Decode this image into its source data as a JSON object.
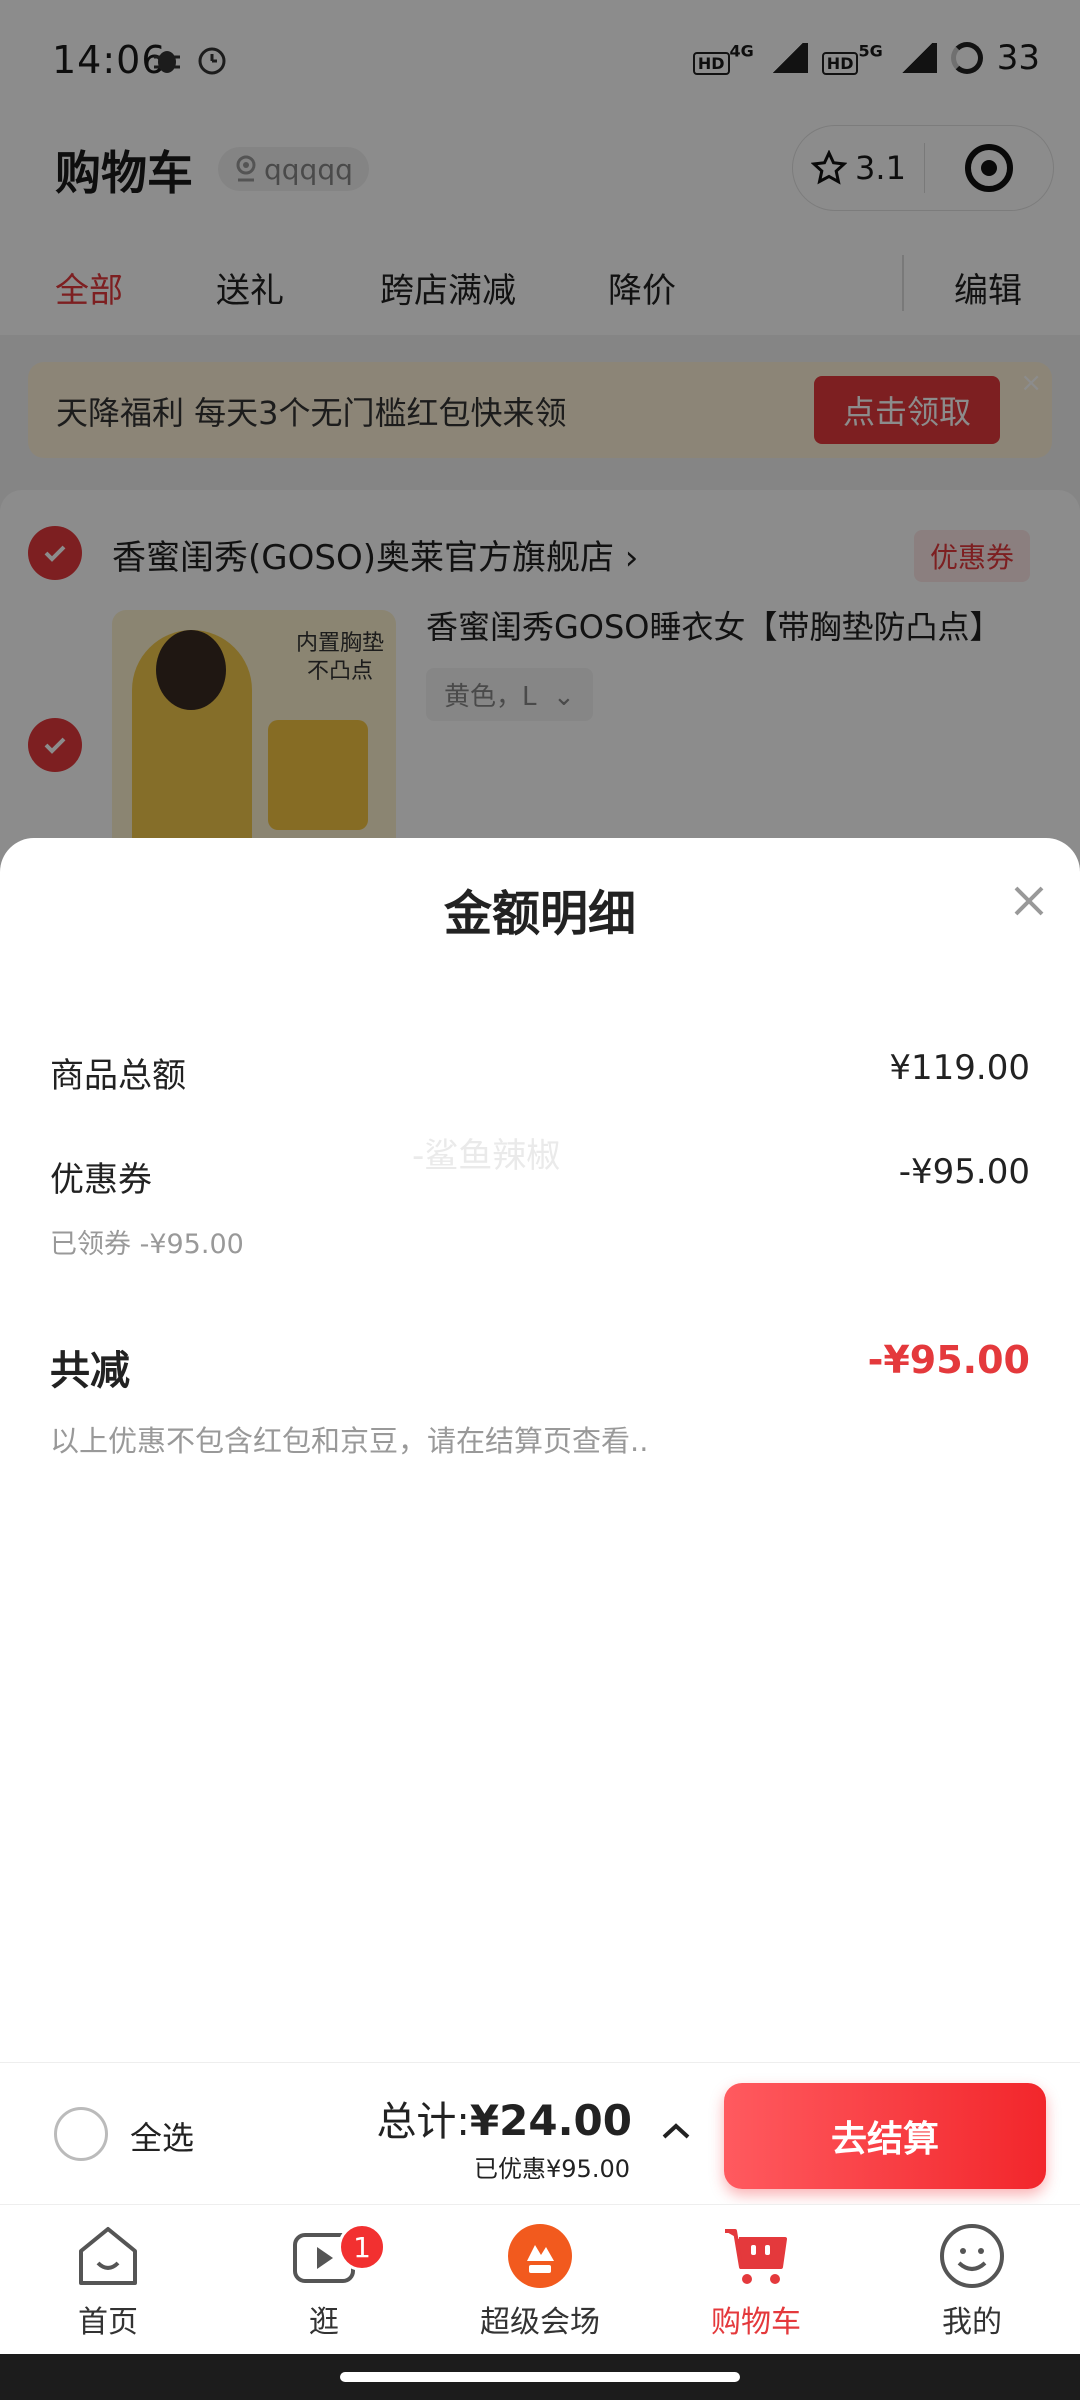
{
  "status_bar": {
    "time": "14:06",
    "network_1": "HD",
    "network_1_gen": "4G",
    "network_2": "HD",
    "network_2_gen": "5G",
    "battery": "33"
  },
  "header": {
    "title": "购物车",
    "address": "qqqqq",
    "capsule_rating": "3.1"
  },
  "tabs": [
    {
      "label": "全部",
      "active": true
    },
    {
      "label": "送礼",
      "active": false
    },
    {
      "label": "跨店满减",
      "active": false
    },
    {
      "label": "降价",
      "active": false
    }
  ],
  "edit_label": "编辑",
  "banner": {
    "text": "天降福利 每天3个无门槛红包快来领",
    "button": "点击领取",
    "close": "×"
  },
  "store": {
    "name": "香蜜闺秀(GOSO)奥莱官方旗舰店",
    "chevron": "›",
    "coupon_tag": "优惠券",
    "product": {
      "title": "香蜜闺秀GOSO睡衣女【带胸垫防凸点】",
      "sku": "黄色，L",
      "sku_arrow": "⌄",
      "image_caption_line1": "内置胸垫",
      "image_caption_line2": "不凸点"
    }
  },
  "sheet": {
    "title": "金额明细",
    "goods_total_label": "商品总额",
    "goods_total_value": "¥119.00",
    "coupon_label": "优惠券",
    "coupon_value": "-¥95.00",
    "coupon_sub": "已领券 -¥95.00",
    "watermark": "-鲨鱼辣椒",
    "total_discount_label": "共减",
    "total_discount_value": "-¥95.00",
    "note": "以上优惠不包含红包和京豆，请在结算页查看.."
  },
  "checkout": {
    "select_all": "全选",
    "total_prefix": "总计:",
    "total_amount": "¥24.00",
    "saved": "已优惠¥95.00",
    "button": "去结算"
  },
  "tabbar": [
    {
      "label": "首页",
      "icon": "home-icon"
    },
    {
      "label": "逛",
      "icon": "video-icon",
      "badge": "1"
    },
    {
      "label": "超级会场",
      "icon": "super-venue-icon"
    },
    {
      "label": "购物车",
      "icon": "cart-icon",
      "active": true
    },
    {
      "label": "我的",
      "icon": "profile-icon"
    }
  ],
  "colors": {
    "accent": "#e4393c",
    "checkout_button": "#f2262b",
    "banner_bg": "#fff3d9"
  }
}
